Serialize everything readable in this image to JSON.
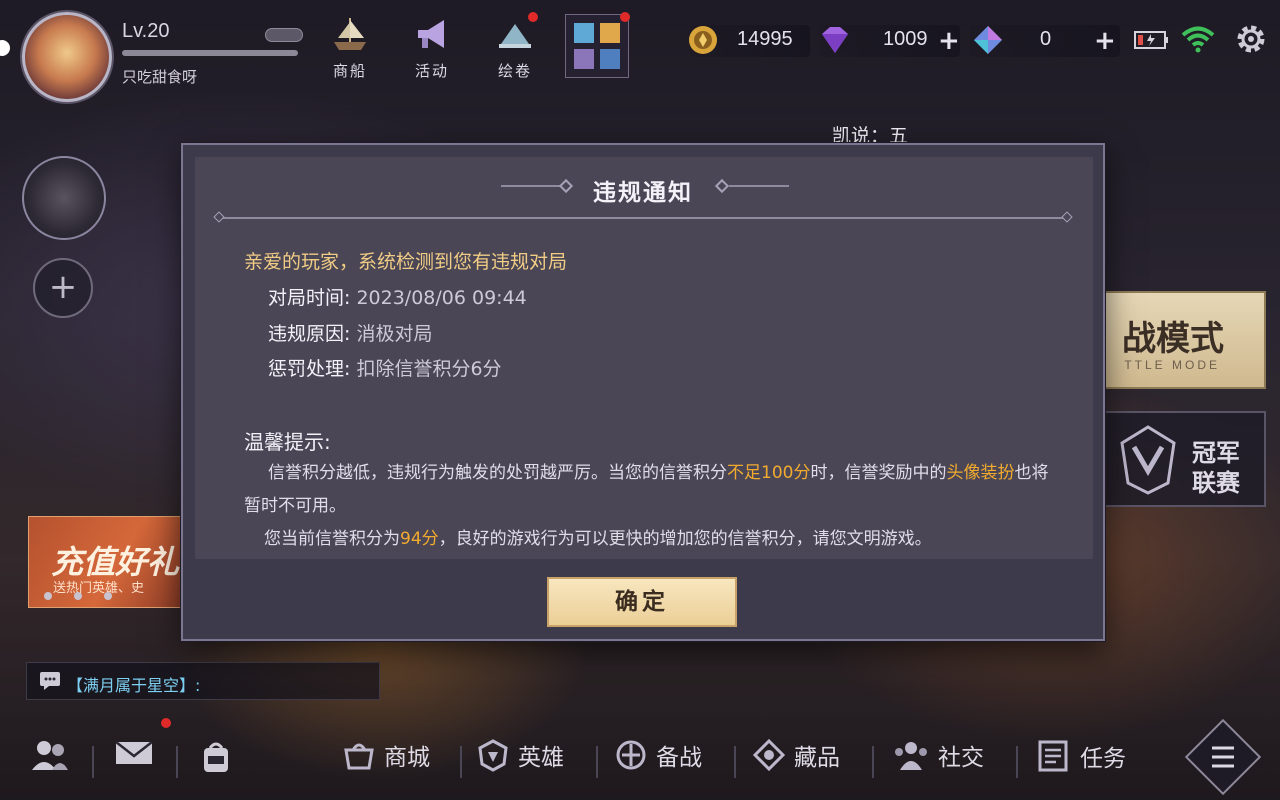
{
  "player": {
    "level": "Lv.20",
    "nickname": "只吃甜食呀"
  },
  "top_menu": [
    {
      "label": "商船",
      "icon": "ship-icon"
    },
    {
      "label": "活动",
      "icon": "megaphone-icon"
    },
    {
      "label": "绘卷",
      "icon": "scroll-icon"
    }
  ],
  "currency": {
    "gold": "14995",
    "diamond": "1009",
    "crystal": "0"
  },
  "marquee": "凯说：五",
  "left_panel": {
    "add_label": "+",
    "banner_title": "充值好礼",
    "banner_subtitle": "送热门英雄、史"
  },
  "chat": {
    "text": "【满月属于星空】:"
  },
  "right_panel": {
    "battle_mode_title": "战模式",
    "battle_mode_subtitle": "TTLE MODE",
    "league_line1": "冠军",
    "league_line2": "联赛"
  },
  "bottom_nav": [
    {
      "label": "商城",
      "icon": "shop-icon"
    },
    {
      "label": "英雄",
      "icon": "hero-icon"
    },
    {
      "label": "备战",
      "icon": "prepare-icon"
    },
    {
      "label": "藏品",
      "icon": "collection-icon"
    },
    {
      "label": "社交",
      "icon": "social-icon"
    },
    {
      "label": "任务",
      "icon": "task-icon"
    }
  ],
  "dialog": {
    "title": "违规通知",
    "greeting": "亲爱的玩家，系统检测到您有违规对局",
    "rows": [
      {
        "key": "对局时间:",
        "value": "2023/08/06 09:44"
      },
      {
        "key": "违规原因:",
        "value": "消极对局"
      },
      {
        "key": "惩罚处理:",
        "value": "扣除信誉积分6分"
      }
    ],
    "tip_title": "温馨提示:",
    "tip1_a": "信誉积分越低，违规行为触发的处罚越严厉。当您的信誉积分",
    "tip1_hl1": "不足100分",
    "tip1_b": "时，信誉奖励中的",
    "tip1_hl2": "头像装扮",
    "tip1_c": "也将暂时不可用。",
    "tip2_a": "您当前信誉积分为",
    "tip2_hl": "94分",
    "tip2_b": "，良好的游戏行为可以更快的增加您的信誉积分，请您文明游戏。",
    "confirm_label": "确定"
  },
  "colors": {
    "highlight": "#f2ab2e",
    "greeting": "#f1cc85",
    "confirm_bg": "#eccf97",
    "dialog_bg": "#4a4656"
  }
}
